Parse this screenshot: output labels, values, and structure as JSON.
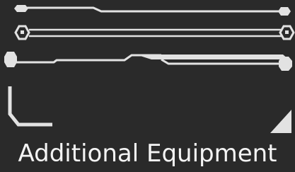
{
  "caption": "Additional Equipment",
  "palette": {
    "background": "#2a2a2a",
    "frame_stroke": "#e2e2e2",
    "caption_text": "#f4f4f4"
  },
  "pieces": [
    "top-divider",
    "double-rail-divider",
    "wide-bevel-bar",
    "corner-bracket",
    "corner-triangle"
  ]
}
